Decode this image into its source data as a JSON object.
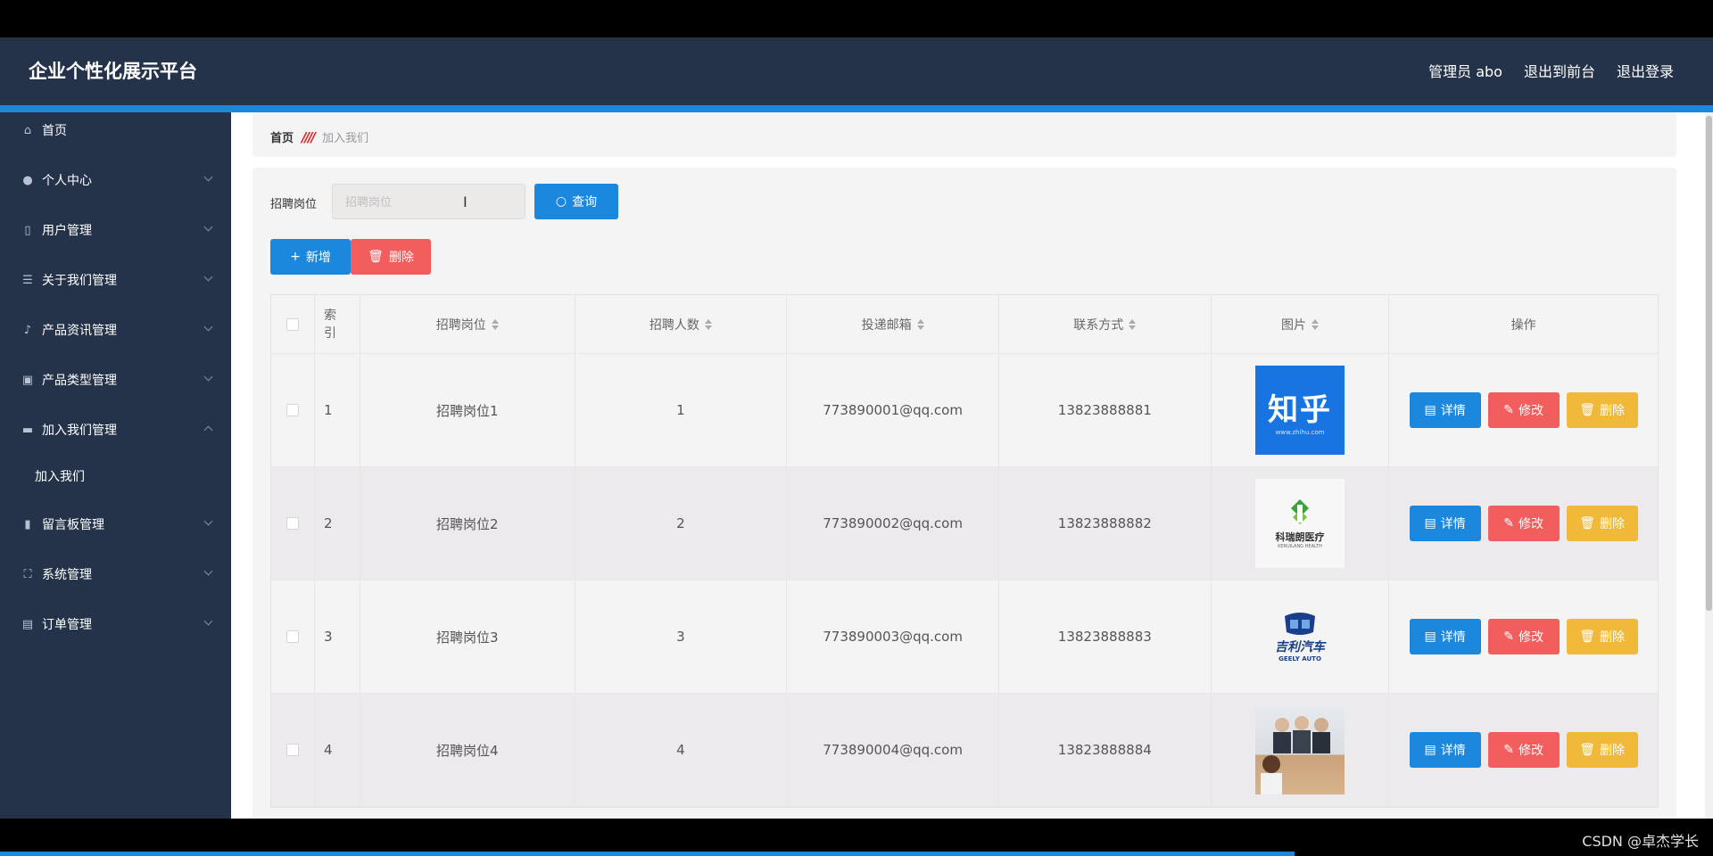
{
  "app": {
    "title": "企业个性化展示平台",
    "header_links": [
      "管理员 abo",
      "退出到前台",
      "退出登录"
    ]
  },
  "sidebar": {
    "items": [
      {
        "label": "首页",
        "icon": "home-icon"
      },
      {
        "label": "个人中心",
        "icon": "user-icon"
      },
      {
        "label": "用户管理",
        "icon": "phone-icon"
      },
      {
        "label": "关于我们管理",
        "icon": "list-icon"
      },
      {
        "label": "产品资讯管理",
        "icon": "mic-icon"
      },
      {
        "label": "产品类型管理",
        "icon": "box-icon"
      },
      {
        "label": "加入我们管理",
        "icon": "monitor-icon"
      },
      {
        "label": "留言板管理",
        "icon": "bar-chart-icon"
      },
      {
        "label": "系统管理",
        "icon": "fullscreen-icon"
      },
      {
        "label": "订单管理",
        "icon": "clipboard-icon"
      }
    ],
    "sub_item": "加入我们"
  },
  "breadcrumb": {
    "home": "首页",
    "separator": "////",
    "current": "加入我们"
  },
  "search": {
    "label": "招聘岗位",
    "placeholder": "招聘岗位",
    "button": "查询"
  },
  "actions": {
    "add": "新增",
    "delete": "删除"
  },
  "table": {
    "headers": {
      "index": "索引",
      "position": "招聘岗位",
      "count": "招聘人数",
      "email": "投递邮箱",
      "phone": "联系方式",
      "image": "图片",
      "ops": "操作"
    },
    "rows": [
      {
        "index": "1",
        "position": "招聘岗位1",
        "count": "1",
        "email": "773890001@qq.com",
        "phone": "13823888881",
        "image_big": "知乎",
        "image_small": "www.zhihu.com"
      },
      {
        "index": "2",
        "position": "招聘岗位2",
        "count": "2",
        "email": "773890002@qq.com",
        "phone": "13823888882",
        "image_big": "科瑞朗医疗",
        "image_small": "KERUILANG HEALTH"
      },
      {
        "index": "3",
        "position": "招聘岗位3",
        "count": "3",
        "email": "773890003@qq.com",
        "phone": "13823888883",
        "image_big": "吉利汽车",
        "image_small": "GEELY AUTO"
      },
      {
        "index": "4",
        "position": "招聘岗位4",
        "count": "4",
        "email": "773890004@qq.com",
        "phone": "13823888884",
        "image_big": "",
        "image_small": ""
      }
    ],
    "op_labels": {
      "view": "详情",
      "edit": "修改",
      "delete": "删除"
    }
  },
  "watermark": "CSDN @卓杰学长",
  "colors": {
    "header_bg": "#25334a",
    "accent": "#1b88dd",
    "danger": "#f25d5d",
    "warning": "#f0b93a"
  }
}
